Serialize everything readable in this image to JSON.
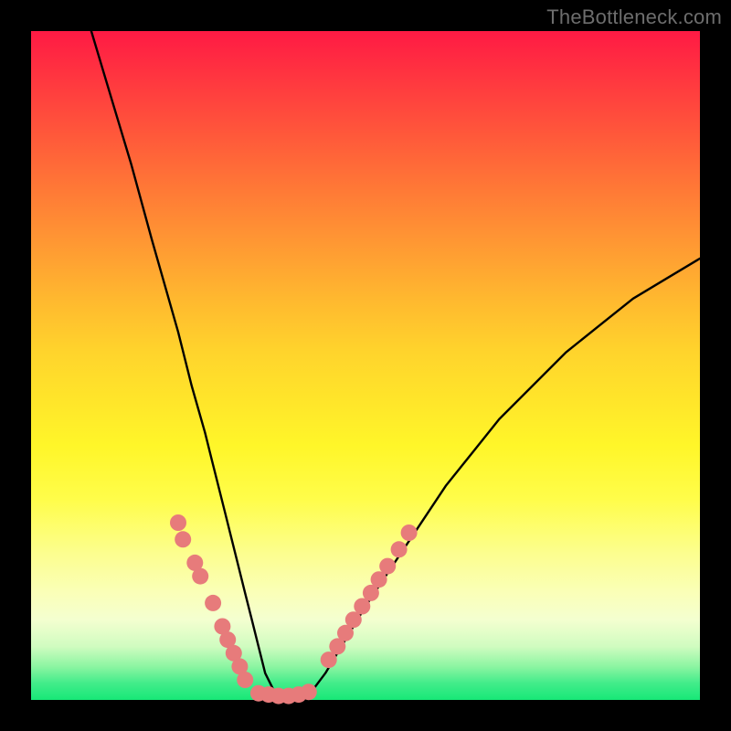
{
  "watermark": "TheBottleneck.com",
  "chart_data": {
    "type": "line",
    "title": "",
    "xlabel": "",
    "ylabel": "",
    "xlim": [
      0,
      100
    ],
    "ylim": [
      0,
      100
    ],
    "grid": false,
    "curve": {
      "x": [
        9,
        12,
        15,
        18,
        20,
        22,
        24,
        26,
        27,
        29,
        30,
        31,
        32,
        33,
        34,
        35,
        37,
        39,
        41,
        44,
        47,
        50,
        54,
        58,
        62,
        66,
        70,
        75,
        80,
        85,
        90,
        95,
        100
      ],
      "y": [
        100,
        90,
        80,
        69,
        62,
        55,
        47,
        40,
        36,
        28,
        24,
        20,
        16,
        12,
        8,
        4,
        0,
        0,
        0,
        4,
        9,
        14,
        20,
        26,
        32,
        37,
        42,
        47,
        52,
        56,
        60,
        63,
        66
      ]
    },
    "dot_series": [
      {
        "name": "left-dots",
        "x": [
          22.0,
          22.7,
          24.5,
          25.3,
          27.2,
          28.6,
          29.4,
          30.3,
          31.2,
          32.0
        ],
        "y": [
          26.5,
          24.0,
          20.5,
          18.5,
          14.5,
          11.0,
          9.0,
          7.0,
          5.0,
          3.0
        ]
      },
      {
        "name": "right-dots",
        "x": [
          44.5,
          45.8,
          47.0,
          48.2,
          49.5,
          50.8,
          52.0,
          53.3,
          55.0,
          56.5
        ],
        "y": [
          6.0,
          8.0,
          10.0,
          12.0,
          14.0,
          16.0,
          18.0,
          20.0,
          22.5,
          25.0
        ]
      },
      {
        "name": "bottom-dots",
        "x": [
          34.0,
          35.5,
          37.0,
          38.5,
          40.0,
          41.5
        ],
        "y": [
          1.0,
          0.8,
          0.6,
          0.6,
          0.8,
          1.2
        ]
      }
    ],
    "dot_color": "#e77b7b",
    "dot_radius_px": 9
  }
}
